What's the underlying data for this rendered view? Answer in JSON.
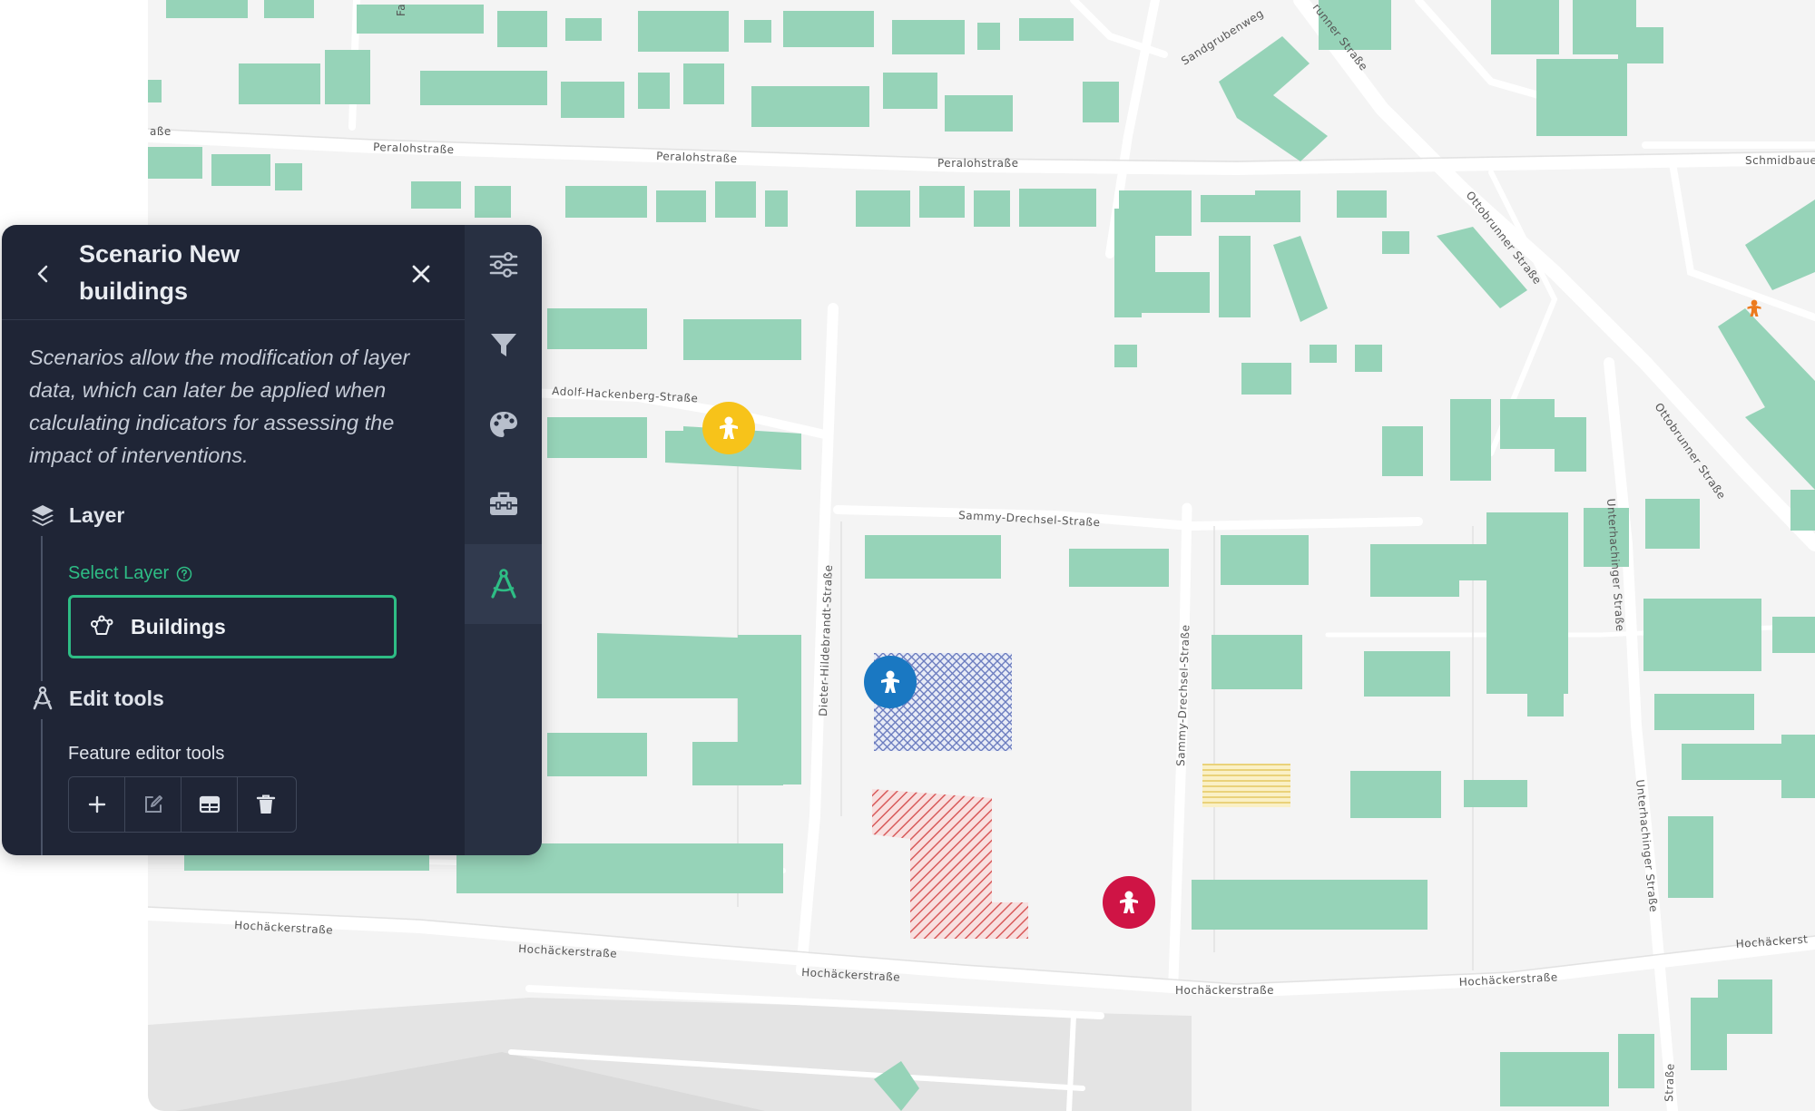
{
  "map": {
    "streets": {
      "peralohstrasse_1": "Peralohstraße",
      "peralohstrasse_2": "Peralohstraße",
      "peralohstrasse_3": "Peralohstraße",
      "adolf_hackenberg": "Adolf-Hackenberg-Straße",
      "sammy_drechsel_h": "Sammy-Drechsel-Straße",
      "sammy_drechsel_v": "Sammy-Drechsel-Straße",
      "dieter_hildebrandt": "Dieter-Hildebrandt-Straße",
      "hochaecker_1": "Hochäckerstraße",
      "hochaecker_2": "Hochäckerstraße",
      "hochaecker_3": "Hochäckerstraße",
      "hochaecker_4": "Hochäckerstraße",
      "hochaecker_5": "Hochäckerstraße",
      "hochaecker_6": "Hochäckerst",
      "ottobrunner_1": "Ottobrunner Straße",
      "ottobrunner_2": "Ottobrunner Straße",
      "ottobrunner_3": "runner Straße",
      "unterhachinger_1": "Unterhachinger Straße",
      "unterhachinger_2": "Unterhachinger Straße",
      "unterhachinger_3": "Straße",
      "sandgruben": "Sandgrubenweg",
      "schmidbauer": "Schmidbaue",
      "partial_left": "aße",
      "partial_top": "Fa"
    },
    "colors": {
      "background": "#f4f4f4",
      "building": "#96d3b8",
      "road": "#ffffff",
      "marker_yellow": "#f7c31a",
      "marker_blue": "#1a78c2",
      "marker_red": "#cf1445"
    }
  },
  "panel": {
    "title": "Scenario New buildings",
    "description": "Scenarios allow the modification of layer data, which can later be applied when calculating indicators for assessing the impact of interventions.",
    "layer_section": {
      "heading": "Layer",
      "select_label": "Select Layer",
      "selected_value": "Buildings"
    },
    "edit_section": {
      "heading": "Edit tools",
      "feature_label": "Feature editor tools"
    },
    "colors": {
      "background": "#1f2536",
      "rail": "#283042",
      "accent": "#2ebd85"
    }
  }
}
